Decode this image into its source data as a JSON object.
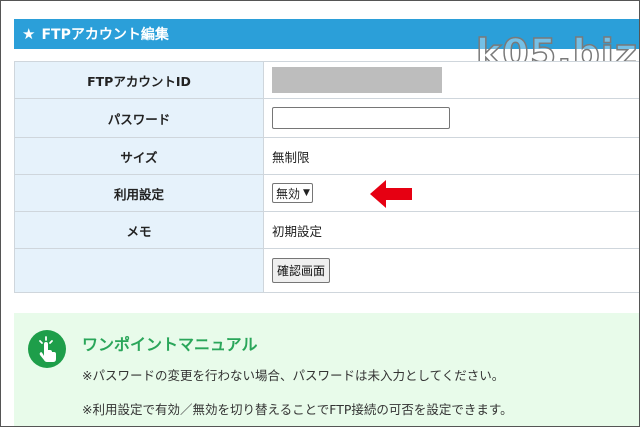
{
  "header": {
    "icon": "star-icon",
    "title": "FTPアカウント編集"
  },
  "watermark": "k05.biz",
  "form": {
    "ftp_account_id_label": "FTPアカウントID",
    "password_label": "パスワード",
    "password_value": "",
    "size_label": "サイズ",
    "size_value": "無制限",
    "usage_label": "利用設定",
    "usage_selected": "無効",
    "memo_label": "メモ",
    "memo_value": "初期設定",
    "confirm_button": "確認画面"
  },
  "manual": {
    "icon": "hand-pointer-icon",
    "title": "ワンポイントマニュアル",
    "notes": [
      "※パスワードの変更を行わない場合、パスワードは未入力としてください。",
      "※利用設定で有効／無効を切り替えることでFTP接続の可否を設定できます。"
    ]
  },
  "colors": {
    "header_bg": "#2b9fd9",
    "label_bg": "#e6f2fb",
    "manual_bg": "#e8fbea",
    "manual_title": "#2aa65a",
    "arrow": "#e60012"
  }
}
